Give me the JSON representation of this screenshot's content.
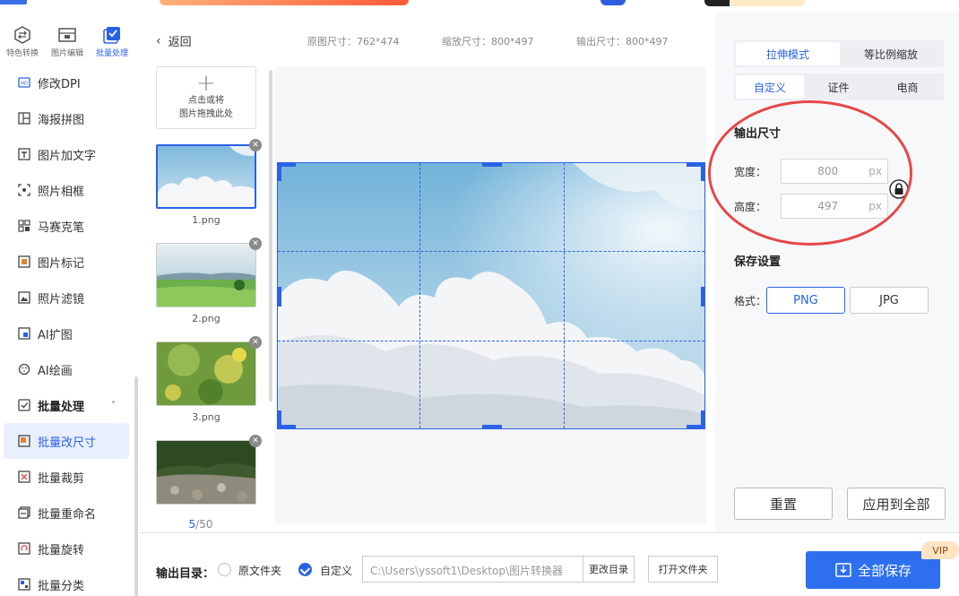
{
  "nav": {
    "top_tabs": [
      {
        "label": "特色转换",
        "icon": "convert-icon"
      },
      {
        "label": "图片编辑",
        "icon": "image-edit-icon"
      },
      {
        "label": "批量处理",
        "icon": "batch-check-icon"
      }
    ],
    "items": [
      {
        "label": "修改DPI",
        "icon": "hd-icon"
      },
      {
        "label": "海报拼图",
        "icon": "layout-icon"
      },
      {
        "label": "图片加文字",
        "icon": "text-image-icon"
      },
      {
        "label": "照片相框",
        "icon": "frame-icon"
      },
      {
        "label": "马赛克笔",
        "icon": "mosaic-icon"
      },
      {
        "label": "图片标记",
        "icon": "mark-icon"
      },
      {
        "label": "照片滤镜",
        "icon": "filter-icon"
      },
      {
        "label": "AI扩图",
        "icon": "ai-expand-icon"
      },
      {
        "label": "AI绘画",
        "icon": "ai-paint-icon"
      }
    ],
    "group": {
      "label": "批量处理",
      "caret": "˄"
    },
    "group_items": [
      {
        "label": "批量改尺寸",
        "icon": "resize-icon",
        "active": true
      },
      {
        "label": "批量裁剪",
        "icon": "crop-icon"
      },
      {
        "label": "批量重命名",
        "icon": "rename-icon"
      },
      {
        "label": "批量旋转",
        "icon": "rotate-icon"
      },
      {
        "label": "批量分类",
        "icon": "classify-icon"
      }
    ]
  },
  "header": {
    "back_label": "返回",
    "orig_size": "原图尺寸：762*474",
    "scale_size": "缩放尺寸：800*497",
    "output_size": "输出尺寸：800*497"
  },
  "thumbs": {
    "add_line1": "点击或将",
    "add_line2": "图片拖拽此处",
    "items": [
      {
        "name": "1.png"
      },
      {
        "name": "2.png"
      },
      {
        "name": "3.png"
      },
      {
        "name": ""
      }
    ],
    "counter_current": "5",
    "counter_total": "/50"
  },
  "right": {
    "mode_tabs": [
      "拉伸模式",
      "等比例缩放"
    ],
    "preset_tabs": [
      "自定义",
      "证件",
      "电商"
    ],
    "output_title": "输出尺寸",
    "width_label": "宽度：",
    "width_value": "800",
    "height_label": "高度：",
    "height_value": "497",
    "unit": "px",
    "save_title": "保存设置",
    "format_label": "格式：",
    "formats": [
      "PNG",
      "JPG"
    ],
    "reset": "重置",
    "apply_all": "应用到全部"
  },
  "bottom": {
    "output_dir_label": "输出目录：",
    "opt_original": "原文件夹",
    "opt_custom": "自定义",
    "path": "C:\\Users\\yssoft1\\Desktop\\图片转换器",
    "change_dir": "更改目录",
    "open_folder": "打开文件夹",
    "save_all": "全部保存",
    "vip": "VIP"
  },
  "colors": {
    "accent": "#2a62e6",
    "annotation": "#e54848"
  }
}
